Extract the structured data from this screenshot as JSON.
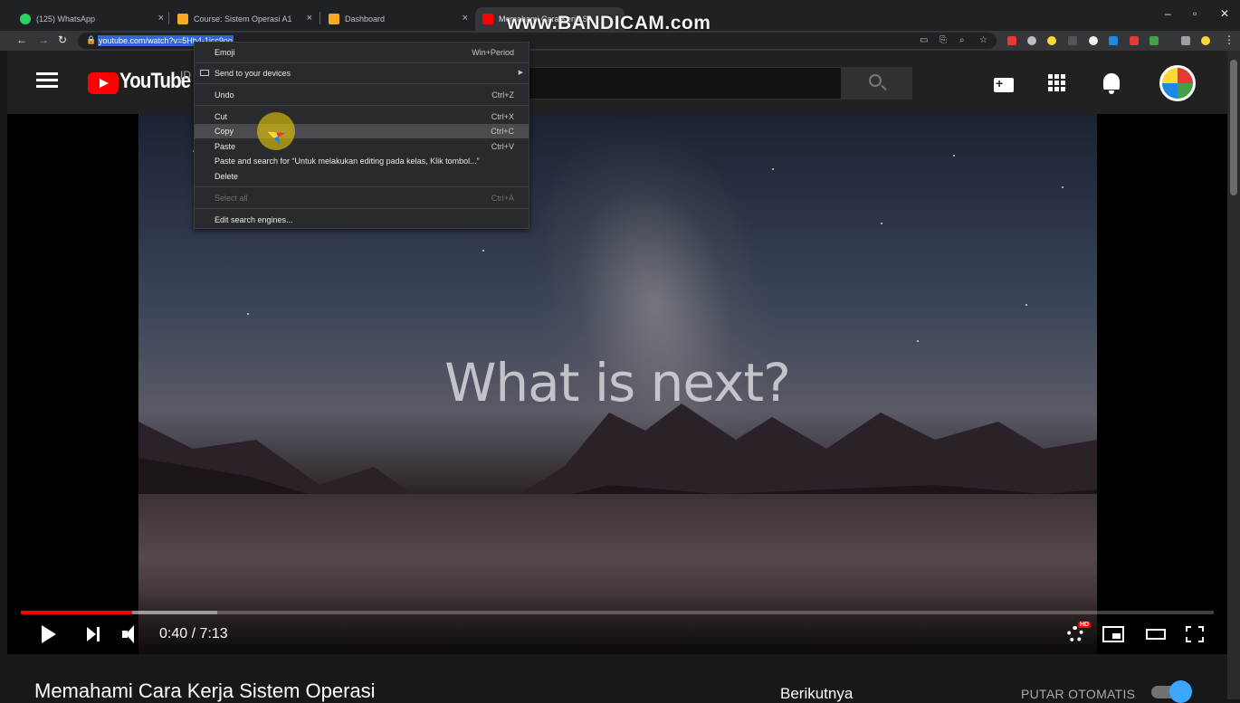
{
  "browser": {
    "tabs": [
      {
        "title": "(125) WhatsApp",
        "favicon_color": "#25d366"
      },
      {
        "title": "Course: Sistem Operasi A1",
        "favicon_color": "#f9a825"
      },
      {
        "title": "Dashboard",
        "favicon_color": "#f9a825"
      },
      {
        "title": "Memahami Cara Kerja Si",
        "favicon_color": "#ff0000"
      }
    ],
    "url": "youtube.com/watch?v=5Hb4-1jcc9oo",
    "window_controls": {
      "minimize": "–",
      "restore": "▫",
      "close": "✕"
    }
  },
  "watermark": "www.BANDICAM.com",
  "youtube": {
    "logo_text": "YouTube",
    "country_code": "ID",
    "search_placeholder": ""
  },
  "player": {
    "overlay_text": "What is next?",
    "time": "0:40 / 7:13",
    "progress_played_fraction": 0.0935,
    "progress_buffered_fraction": 0.165,
    "hd_badge": "HD"
  },
  "below_player": {
    "title": "Memahami Cara Kerja Sistem Operasi",
    "next_label": "Berikutnya",
    "autoplay_label": "PUTAR OTOMATIS",
    "autoplay_on": true
  },
  "context_menu": {
    "items": [
      {
        "label": "Emoji",
        "shortcut": "Win+Period"
      },
      {
        "label": "Send to your devices",
        "shortcut": ""
      },
      {
        "label": "Undo",
        "shortcut": "Ctrl+Z"
      },
      {
        "label": "Cut",
        "shortcut": "Ctrl+X"
      },
      {
        "label": "Copy",
        "shortcut": "Ctrl+C"
      },
      {
        "label": "Paste",
        "shortcut": "Ctrl+V"
      },
      {
        "label": "Paste and search for “Untuk melakukan editing pada kelas, Klik tombol...”",
        "shortcut": ""
      },
      {
        "label": "Delete",
        "shortcut": ""
      },
      {
        "label": "Select all",
        "shortcut": "Ctrl+A"
      },
      {
        "label": "Edit search engines...",
        "shortcut": ""
      }
    ]
  },
  "colors": {
    "accent_red": "#ff0000",
    "autoplay_blue": "#3ea6ff",
    "url_selection": "#3367d6"
  }
}
